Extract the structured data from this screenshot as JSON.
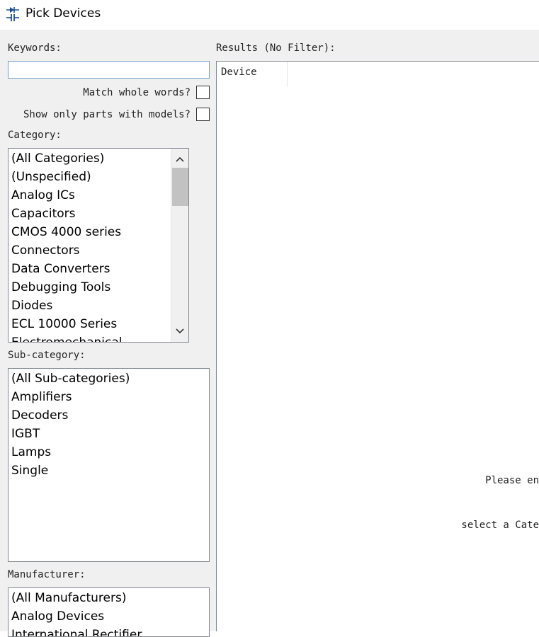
{
  "window": {
    "title": "Pick Devices",
    "icon": "diode-capacitor-icon"
  },
  "keywords": {
    "label": "Keywords:",
    "value": "",
    "placeholder": ""
  },
  "options": {
    "match_whole_words_label": "Match whole words?",
    "match_whole_words_checked": false,
    "only_models_label": "Show only parts with models?",
    "only_models_checked": false
  },
  "category": {
    "label": "Category:",
    "items": [
      "(All Categories)",
      "(Unspecified)",
      "Analog ICs",
      "Capacitors",
      "CMOS 4000 series",
      "Connectors",
      "Data Converters",
      "Debugging Tools",
      "Diodes",
      "ECL 10000 Series",
      "Electromechanical"
    ]
  },
  "subcategory": {
    "label": "Sub-category:",
    "items": [
      "(All Sub-categories)",
      "Amplifiers",
      "Decoders",
      "IGBT",
      "Lamps",
      "Single"
    ]
  },
  "manufacturer": {
    "label": "Manufacturer:",
    "items": [
      "(All Manufacturers)",
      "Analog Devices",
      "International Rectifier"
    ]
  },
  "results": {
    "label": "Results (No Filter):",
    "column_device": "Device",
    "empty_line1": "Please en",
    "empty_line2": "select a Cate"
  },
  "colors": {
    "client_bg": "#f0f0f0",
    "input_border": "#7a9cc6",
    "list_border": "#828790",
    "scroll_thumb": "#c2c2c2"
  }
}
